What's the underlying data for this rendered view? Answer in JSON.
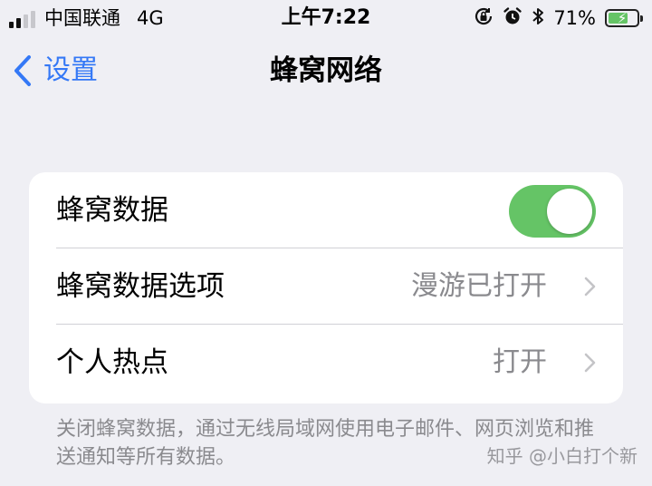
{
  "status_bar": {
    "carrier": "中国联通",
    "network": "4G",
    "time": "上午7:22",
    "battery_percent": "71%",
    "battery_level": 0.71,
    "battery_bolt": "⚡",
    "signal_bars_filled": 2,
    "signal_bars_total": 4,
    "icons": [
      "orientation-lock-icon",
      "alarm-icon",
      "bluetooth-icon",
      "battery-icon"
    ]
  },
  "nav": {
    "back_label": "设置",
    "title": "蜂窝网络"
  },
  "rows": [
    {
      "label": "蜂窝数据",
      "toggle_on": true
    },
    {
      "label": "蜂窝数据选项",
      "value": "漫游已打开"
    },
    {
      "label": "个人热点",
      "value": "打开"
    }
  ],
  "footer": {
    "note": "关闭蜂窝数据，通过无线局域网使用电子邮件、网页浏览和推送通知等所有数据。"
  },
  "watermark": "知乎 @小白打个新",
  "colors": {
    "accent": "#3478f6",
    "toggle_on": "#65c466",
    "background": "#efeff4",
    "secondary_text": "#8a8a8e",
    "chevron": "#c4c4c7",
    "battery_fill": "#65c466"
  }
}
